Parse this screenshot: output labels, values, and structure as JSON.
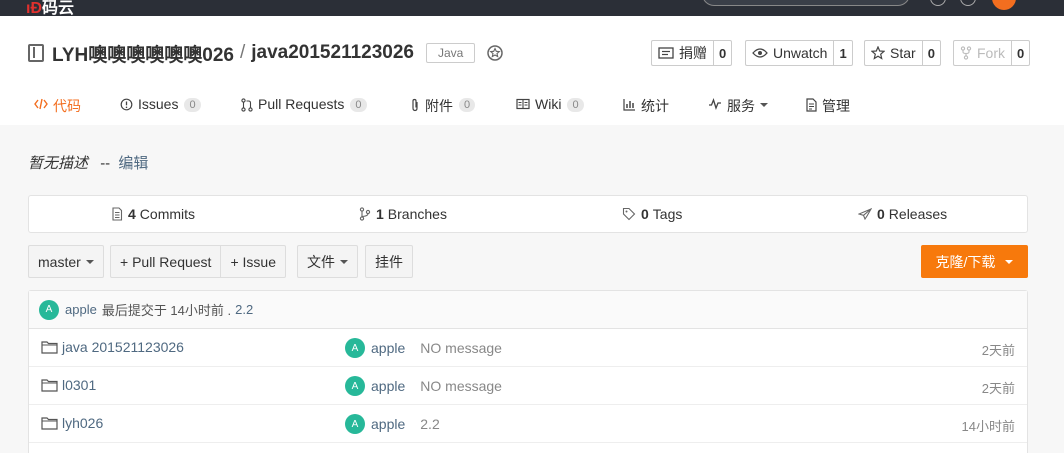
{
  "repo": {
    "owner": "LYH噢噢噢噢噢噢026",
    "separator": "/",
    "name": "java201521123026",
    "language": "Java"
  },
  "actions": [
    {
      "label": "捐赠",
      "count": "0",
      "icon": "donate-icon"
    },
    {
      "label": "Unwatch",
      "count": "1",
      "icon": "eye-icon"
    },
    {
      "label": "Star",
      "count": "0",
      "icon": "star-icon"
    },
    {
      "label": "Fork",
      "count": "0",
      "icon": "fork-icon"
    }
  ],
  "tabs": [
    {
      "label": "代码",
      "icon": "code-icon",
      "active": true
    },
    {
      "label": "Issues",
      "count": "0",
      "icon": "issue-icon"
    },
    {
      "label": "Pull Requests",
      "count": "0",
      "icon": "pull-request-icon"
    },
    {
      "label": "附件",
      "count": "0",
      "icon": "attachment-icon"
    },
    {
      "label": "Wiki",
      "count": "0",
      "icon": "wiki-icon"
    },
    {
      "label": "统计",
      "icon": "stats-icon"
    },
    {
      "label": "服务",
      "icon": "service-icon"
    },
    {
      "label": "管理",
      "icon": "manage-icon"
    }
  ],
  "description": {
    "text": "暂无描述",
    "separator": "--",
    "edit_label": "编辑"
  },
  "stats": [
    {
      "count": "4",
      "label": "Commits",
      "icon": "commits-icon"
    },
    {
      "count": "1",
      "label": "Branches",
      "icon": "branch-icon"
    },
    {
      "count": "0",
      "label": "Tags",
      "icon": "tag-icon"
    },
    {
      "count": "0",
      "label": "Releases",
      "icon": "release-icon"
    }
  ],
  "toolbar": {
    "branch": "master",
    "pull_request": "+ Pull Request",
    "issue": "+ Issue",
    "file": "文件",
    "widget": "挂件",
    "clone": "克隆/下载"
  },
  "last_commit": {
    "avatar": "A",
    "author": "apple",
    "text": "最后提交于 14小时前 .",
    "message": "2.2"
  },
  "files": [
    {
      "name": "java 201521123026",
      "avatar": "A",
      "author": "apple",
      "message": "NO message",
      "time": "2天前"
    },
    {
      "name": "l0301",
      "avatar": "A",
      "author": "apple",
      "message": "NO message",
      "time": "2天前"
    },
    {
      "name": "lyh026",
      "avatar": "A",
      "author": "apple",
      "message": "2.2",
      "time": "14小时前"
    }
  ],
  "colors": {
    "accent": "#f36e1f",
    "clone_button": "#f7790c",
    "avatar": "#27b899",
    "link": "#4f6981"
  }
}
